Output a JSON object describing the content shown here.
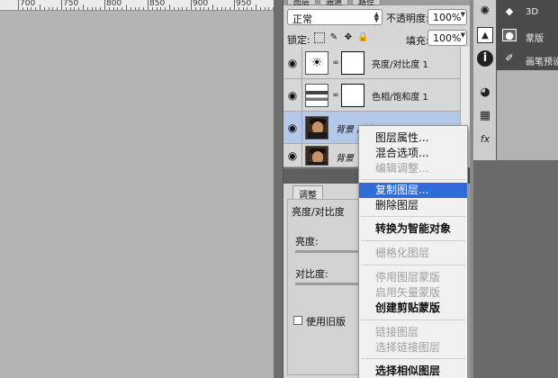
{
  "ruler": {
    "labels": [
      "700",
      "750",
      "800",
      "850",
      "900",
      "950"
    ]
  },
  "panel_tabs": [
    "图层",
    "通道",
    "路径"
  ],
  "layers_panel": {
    "blend_mode": "正常",
    "opacity_label": "不透明度:",
    "opacity_value": "100%",
    "lock_label": "锁定:",
    "fill_label": "填充:",
    "fill_value": "100%",
    "layers": [
      {
        "name": "亮度/对比度 1",
        "kind": "adjustment",
        "icon": "brightness-contrast-icon"
      },
      {
        "name": "色相/饱和度 1",
        "kind": "adjustment",
        "icon": "hue-saturation-icon"
      },
      {
        "name": "背景 副本",
        "kind": "photo",
        "selected": true
      },
      {
        "name": "背景",
        "kind": "photo"
      }
    ]
  },
  "adjustments_panel": {
    "tab": "调整",
    "title": "亮度/对比度",
    "brightness_label": "亮度:",
    "contrast_label": "对比度:",
    "legacy_label": "使用旧版"
  },
  "context_menu": {
    "items": [
      {
        "label": "图层属性...",
        "state": "enabled"
      },
      {
        "label": "混合选项...",
        "state": "enabled"
      },
      {
        "label": "编辑调整...",
        "state": "disabled"
      },
      {
        "label": "复制图层...",
        "state": "highlighted"
      },
      {
        "label": "删除图层",
        "state": "enabled"
      },
      {
        "label": "转换为智能对象",
        "state": "bold"
      },
      {
        "label": "栅格化图层",
        "state": "disabled"
      },
      {
        "label": "停用图层蒙版",
        "state": "disabled"
      },
      {
        "label": "启用矢量蒙版",
        "state": "disabled"
      },
      {
        "label": "创建剪贴蒙版",
        "state": "bold"
      },
      {
        "label": "链接图层",
        "state": "disabled"
      },
      {
        "label": "选择链接图层",
        "state": "disabled"
      },
      {
        "label": "选择相似图层",
        "state": "bold"
      }
    ]
  },
  "dock": {
    "items": [
      {
        "label": "3D",
        "icon": "3d-cube-icon"
      },
      {
        "label": "蒙版",
        "icon": "mask-icon"
      },
      {
        "label": "画笔预设",
        "icon": "brush-preset-icon"
      }
    ],
    "icons": [
      "gear-icon",
      "image-icon",
      "info-icon",
      "palette-icon",
      "grid-icon",
      "fx-icon"
    ]
  },
  "colors": {
    "highlight": "#2f6bd9",
    "selected_layer": "#b4c9e9",
    "canvas_bg": "#b4b4b4"
  }
}
